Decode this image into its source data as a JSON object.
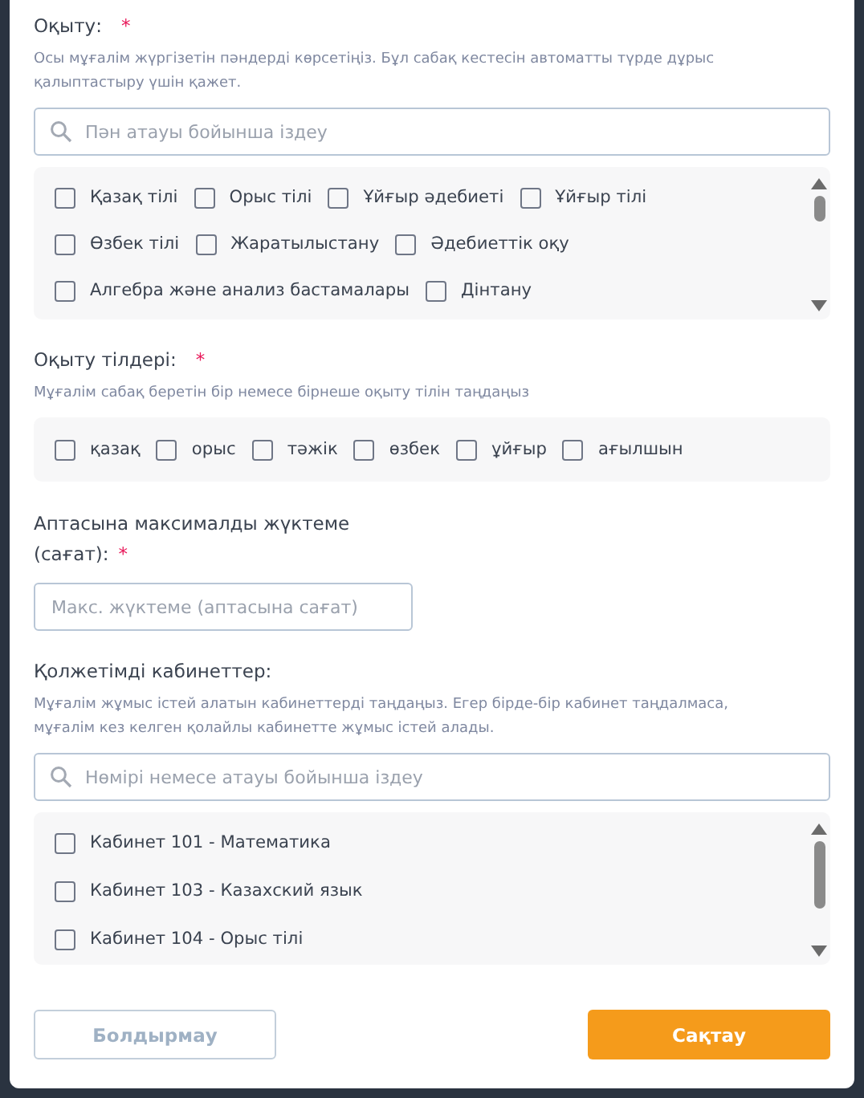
{
  "subjects": {
    "label": "Оқыту:",
    "required_mark": "*",
    "hint": "Осы мұғалім жүргізетін пәндерді көрсетіңіз. Бұл сабақ кестесін автоматты түрде дұрыс қалыптастыру үшін қажет.",
    "search": {
      "placeholder": "Пән атауы бойынша іздеу"
    },
    "items": [
      {
        "label": "Қазақ тілі",
        "checked": false
      },
      {
        "label": "Орыс тілі",
        "checked": false
      },
      {
        "label": "Ұйғыр әдебиеті",
        "checked": false
      },
      {
        "label": "Ұйғыр тілі",
        "checked": false
      },
      {
        "label": "Өзбек тілі",
        "checked": false
      },
      {
        "label": "Жаратылыстану",
        "checked": false
      },
      {
        "label": "Әдебиеттік оқу",
        "checked": false
      },
      {
        "label": "Алгебра және анализ бастамалары",
        "checked": false
      },
      {
        "label": "Дінтану",
        "checked": false
      }
    ]
  },
  "languages": {
    "label": "Оқыту тілдері:",
    "required_mark": "*",
    "hint": "Мұғалім сабақ беретін бір немесе бірнеше оқыту тілін таңдаңыз",
    "items": [
      {
        "label": "қазақ",
        "checked": false
      },
      {
        "label": "орыс",
        "checked": false
      },
      {
        "label": "тәжік",
        "checked": false
      },
      {
        "label": "өзбек",
        "checked": false
      },
      {
        "label": "ұйғыр",
        "checked": false
      },
      {
        "label": "ағылшын",
        "checked": false
      }
    ]
  },
  "max_load": {
    "label": "Аптасына максималды жүктеме (сағат):",
    "required_mark": "*",
    "placeholder": "Макс. жүктеме (аптасына сағат)"
  },
  "rooms": {
    "label": "Қолжетімді кабинеттер:",
    "hint": "Мұғалім жұмыс істей алатын кабинеттерді таңдаңыз. Егер бірде-бір кабинет таңдалмаса, мұғалім кез келген қолайлы кабинетте жұмыс істей алады.",
    "search": {
      "placeholder": "Нөмірі немесе атауы бойынша іздеу"
    },
    "items": [
      {
        "label": "Кабинет 101 - Математика",
        "checked": false
      },
      {
        "label": "Кабинет 103 - Казахский язык",
        "checked": false
      },
      {
        "label": "Кабинет 104 - Орыс тілі",
        "checked": false
      }
    ]
  },
  "buttons": [
    {
      "label": "Болдырмау",
      "kind": "secondary"
    },
    {
      "label": "Сақтау",
      "kind": "primary"
    }
  ]
}
